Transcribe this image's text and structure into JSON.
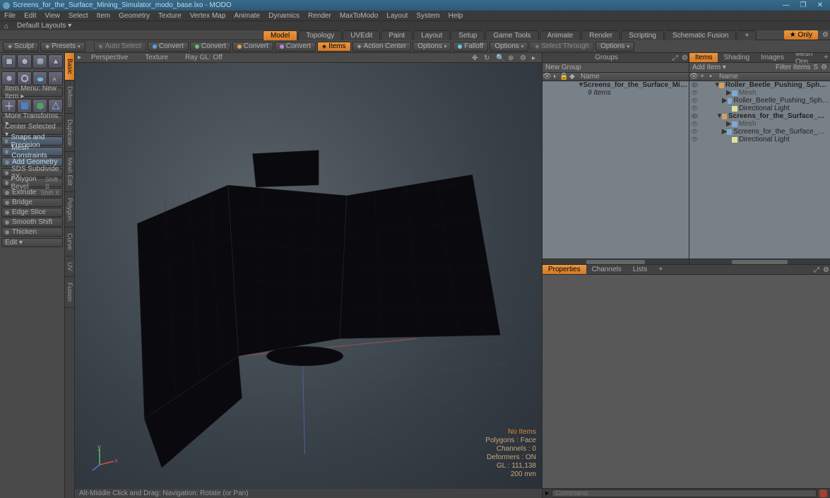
{
  "titlebar": {
    "title": "Screens_for_the_Surface_Mining_Simulator_modo_base.lxo - MODO"
  },
  "menu": [
    "File",
    "Edit",
    "View",
    "Select",
    "Item",
    "Geometry",
    "Texture",
    "Vertex Map",
    "Animate",
    "Dynamics",
    "Render",
    "MaxToModo",
    "Layout",
    "System",
    "Help"
  ],
  "layoutbar": {
    "label": "Default Layouts ▾"
  },
  "tabs": {
    "items": [
      "Model",
      "Topology",
      "UVEdit",
      "Paint",
      "Layout",
      "Setup",
      "Game Tools",
      "Animate",
      "Render",
      "Scripting",
      "Schematic Fusion"
    ],
    "active": 0,
    "only": "★ Only"
  },
  "toolbar": [
    {
      "label": "Sculpt",
      "icon": "brush"
    },
    {
      "label": "Presets",
      "icon": "grid",
      "chev": true
    },
    {
      "sep": true
    },
    {
      "label": "Auto Select",
      "icon": "cursor",
      "dim": true
    },
    {
      "label": "Convert",
      "dot": "#5aa0e0"
    },
    {
      "label": "Convert",
      "dot": "#6ac070"
    },
    {
      "label": "Convert",
      "dot": "#e0a050"
    },
    {
      "label": "Convert",
      "dot": "#c080e0"
    },
    {
      "label": "Items",
      "orange": true,
      "ico": "cube"
    },
    {
      "label": "Action Center",
      "ico": "target"
    },
    {
      "label": "Options",
      "chev": true
    },
    {
      "label": "Falloff",
      "dot": "#60c8e8"
    },
    {
      "label": "Options",
      "chev": true
    },
    {
      "label": "Select Through",
      "ico": "st",
      "dim": true
    },
    {
      "label": "Options",
      "chev": true
    }
  ],
  "verttabs": {
    "items": [
      "Basic",
      "Deform",
      "Duplicate",
      "Mesh Edit",
      "Polygon",
      "Curve",
      "UV",
      "Fusion"
    ],
    "active": 0
  },
  "leftpanel": {
    "row1": "Item Menu: New Item ▸",
    "row2": "More Transforms ▾",
    "row3": "Center Selected ▾",
    "snaps": "Snaps and Precision",
    "meshcon": "Mesh Constraints",
    "addgeom": "Add Geometry",
    "ops": [
      {
        "label": "SDS Subdivide 2X",
        "sc": ""
      },
      {
        "label": "Polygon Bevel",
        "sc": "Shift B"
      },
      {
        "label": "Extrude",
        "sc": "Shift X"
      },
      {
        "label": "Bridge",
        "sc": ""
      },
      {
        "label": "Edge Slice",
        "sc": ""
      },
      {
        "label": "Smooth Shift",
        "sc": ""
      },
      {
        "label": "Thicken",
        "sc": ""
      }
    ],
    "edit": "Edit ▾"
  },
  "viewport": {
    "tabs": [
      "Perspective",
      "Texture",
      "Ray GL: Off"
    ],
    "footer": "Alt-Middle Click and Drag:   Navigation: Rotate (or Pan)",
    "stats": {
      "noitems": "No Items",
      "polys": "Polygons : Face",
      "chans": "Channels : 0",
      "defs": "Deformers : ON",
      "gl": "GL : 111,138",
      "dist": "200 mm"
    }
  },
  "groups": {
    "title": "Groups",
    "newgroup": "New Group",
    "namecol": "Name",
    "rows": [
      {
        "indent": 0,
        "tri": "▼",
        "bold": true,
        "label": "Screens_for_the_Surface_Mini ..."
      },
      {
        "indent": 1,
        "label": "9 Items",
        "italic": true
      }
    ]
  },
  "items": {
    "tabs": [
      "Items",
      "Shading",
      "Images",
      "Mesh Ops"
    ],
    "active": 0,
    "additem": "Add Item ▾",
    "filter": "Filter Items",
    "namecol": "Name",
    "rows": [
      {
        "eye": true,
        "indent": 0,
        "tri": "▼",
        "bold": true,
        "ico": "scene",
        "label": "Roller_Beetle_Pushing_Sphere_Dirt_..."
      },
      {
        "eye": true,
        "indent": 1,
        "tri": "▶",
        "ico": "mesh",
        "label": "Mesh",
        "dim": true
      },
      {
        "eye": true,
        "indent": 1,
        "tri": "▶",
        "ico": "mesh",
        "label": "Roller_Beetle_Pushing_Sphere_Dirt"
      },
      {
        "eye": true,
        "indent": 1,
        "ico": "light",
        "label": "Directional Light"
      },
      {
        "eye": true,
        "indent": 0,
        "tri": "▼",
        "bold": true,
        "ico": "scene",
        "label": "Screens_for_the_Surface_Mini ..."
      },
      {
        "eye": true,
        "indent": 1,
        "tri": "▶",
        "ico": "mesh",
        "label": "Mesh",
        "dim": true
      },
      {
        "eye": true,
        "indent": 1,
        "tri": "▶",
        "ico": "mesh",
        "label": "Screens_for_the_Surface_Mining_..."
      },
      {
        "eye": true,
        "indent": 1,
        "ico": "light",
        "label": "Directional Light"
      }
    ]
  },
  "props": {
    "tabs": [
      "Properties",
      "Channels",
      "Lists"
    ],
    "active": 0
  },
  "cmdbar": {
    "placeholder": "Command"
  }
}
